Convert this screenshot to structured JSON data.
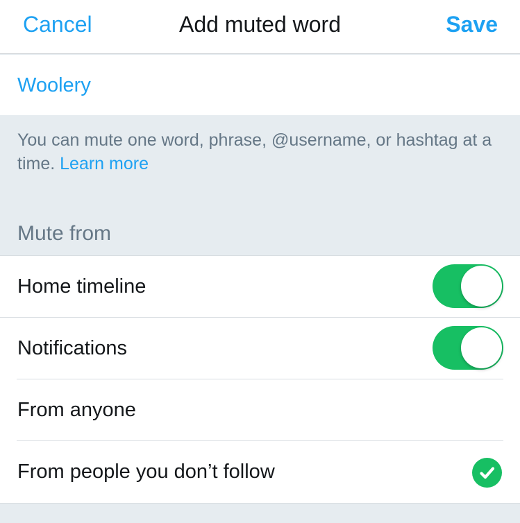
{
  "nav": {
    "cancel": "Cancel",
    "title": "Add muted word",
    "save": "Save"
  },
  "muted_word": {
    "value": "Woolery"
  },
  "hint": {
    "text": "You can mute one word, phrase, @username, or hashtag at a time.",
    "link": "Learn more"
  },
  "mute_from": {
    "header": "Mute from",
    "home_timeline": {
      "label": "Home timeline",
      "on": true
    },
    "notifications": {
      "label": "Notifications",
      "on": true
    },
    "from_anyone": {
      "label": "From anyone",
      "selected": false
    },
    "from_not_following": {
      "label": "From people you don’t follow",
      "selected": true
    }
  },
  "colors": {
    "accent": "#1da1f2",
    "toggle_on": "#17bf63",
    "background": "#e6ecf0",
    "secondary_text": "#657786"
  },
  "icons": {
    "selected_option": "checkmark-circle-icon"
  }
}
